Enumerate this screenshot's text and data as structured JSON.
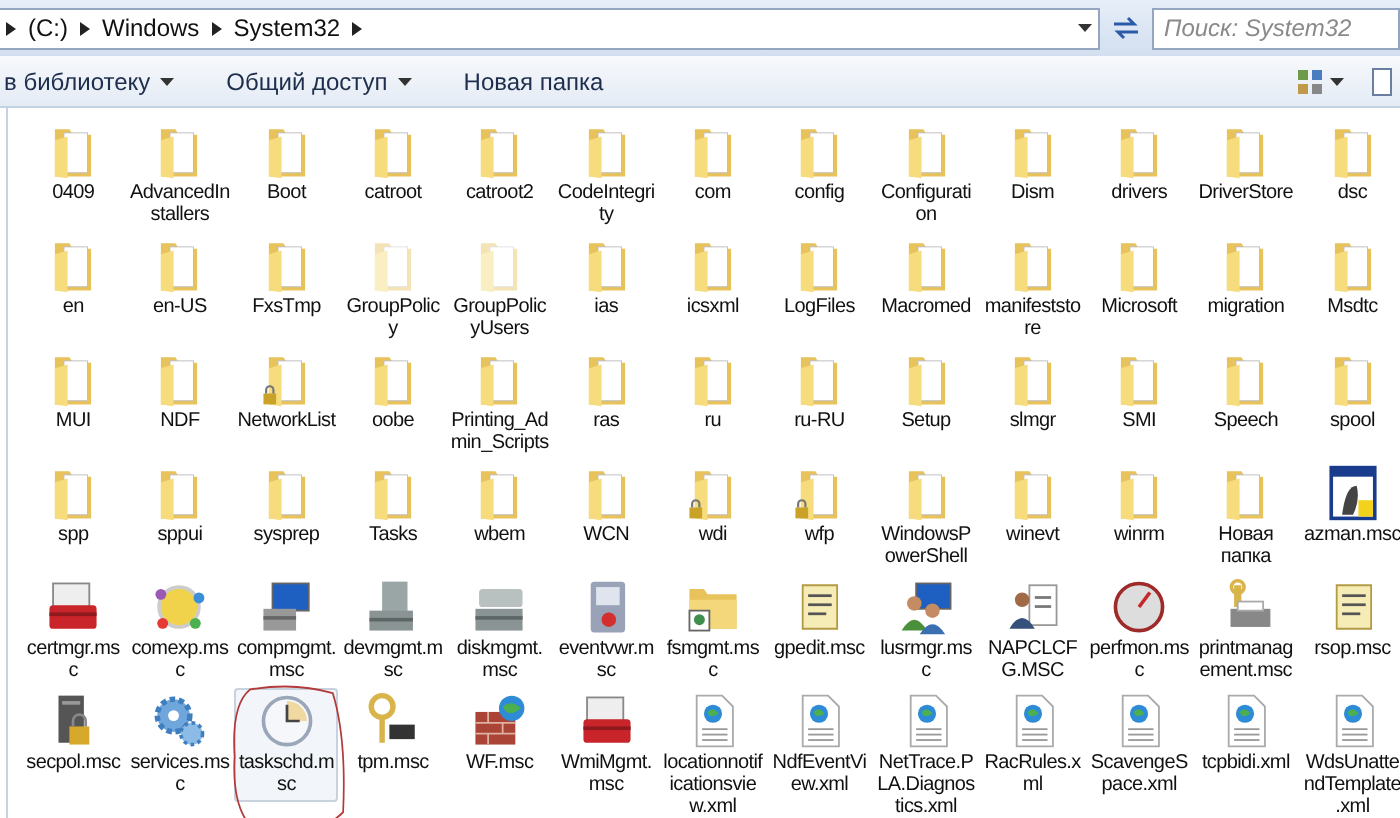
{
  "address_bar": {
    "segments": [
      "(C:)",
      "Windows",
      "System32"
    ]
  },
  "search": {
    "placeholder": "Поиск: System32"
  },
  "toolbar": {
    "buttons": [
      {
        "label": "в библиотеку",
        "menu": true
      },
      {
        "label": "Общий доступ",
        "menu": true
      },
      {
        "label": "Новая папка",
        "menu": false
      }
    ]
  },
  "items": [
    {
      "name": "0409",
      "kind": "folder",
      "selected": false,
      "circled": false
    },
    {
      "name": "AdvancedInstallers",
      "kind": "folder",
      "selected": false,
      "circled": false
    },
    {
      "name": "Boot",
      "kind": "folder",
      "selected": false,
      "circled": false
    },
    {
      "name": "catroot",
      "kind": "folder",
      "selected": false,
      "circled": false
    },
    {
      "name": "catroot2",
      "kind": "folder",
      "selected": false,
      "circled": false
    },
    {
      "name": "CodeIntegrity",
      "kind": "folder",
      "selected": false,
      "circled": false
    },
    {
      "name": "com",
      "kind": "folder",
      "selected": false,
      "circled": false
    },
    {
      "name": "config",
      "kind": "folder",
      "selected": false,
      "circled": false
    },
    {
      "name": "Configuration",
      "kind": "folder",
      "selected": false,
      "circled": false
    },
    {
      "name": "Dism",
      "kind": "folder",
      "selected": false,
      "circled": false
    },
    {
      "name": "drivers",
      "kind": "folder",
      "selected": false,
      "circled": false
    },
    {
      "name": "DriverStore",
      "kind": "folder",
      "selected": false,
      "circled": false
    },
    {
      "name": "dsc",
      "kind": "folder",
      "selected": false,
      "circled": false
    },
    {
      "name": "en",
      "kind": "folder",
      "selected": false,
      "circled": false
    },
    {
      "name": "en-US",
      "kind": "folder",
      "selected": false,
      "circled": false
    },
    {
      "name": "FxsTmp",
      "kind": "folder",
      "selected": false,
      "circled": false
    },
    {
      "name": "GroupPolicy",
      "kind": "hidden-folder",
      "selected": false,
      "circled": false
    },
    {
      "name": "GroupPolicyUsers",
      "kind": "hidden-folder",
      "selected": false,
      "circled": false
    },
    {
      "name": "ias",
      "kind": "folder",
      "selected": false,
      "circled": false
    },
    {
      "name": "icsxml",
      "kind": "folder",
      "selected": false,
      "circled": false
    },
    {
      "name": "LogFiles",
      "kind": "folder",
      "selected": false,
      "circled": false
    },
    {
      "name": "Macromed",
      "kind": "folder",
      "selected": false,
      "circled": false
    },
    {
      "name": "manifeststore",
      "kind": "folder",
      "selected": false,
      "circled": false
    },
    {
      "name": "Microsoft",
      "kind": "folder",
      "selected": false,
      "circled": false
    },
    {
      "name": "migration",
      "kind": "folder",
      "selected": false,
      "circled": false
    },
    {
      "name": "Msdtc",
      "kind": "folder",
      "selected": false,
      "circled": false
    },
    {
      "name": "MUI",
      "kind": "folder",
      "selected": false,
      "circled": false
    },
    {
      "name": "NDF",
      "kind": "folder",
      "selected": false,
      "circled": false
    },
    {
      "name": "NetworkList",
      "kind": "locked-folder",
      "selected": false,
      "circled": false
    },
    {
      "name": "oobe",
      "kind": "folder",
      "selected": false,
      "circled": false
    },
    {
      "name": "Printing_Admin_Scripts",
      "kind": "folder",
      "selected": false,
      "circled": false
    },
    {
      "name": "ras",
      "kind": "folder",
      "selected": false,
      "circled": false
    },
    {
      "name": "ru",
      "kind": "folder",
      "selected": false,
      "circled": false
    },
    {
      "name": "ru-RU",
      "kind": "folder",
      "selected": false,
      "circled": false
    },
    {
      "name": "Setup",
      "kind": "folder",
      "selected": false,
      "circled": false
    },
    {
      "name": "slmgr",
      "kind": "folder",
      "selected": false,
      "circled": false
    },
    {
      "name": "SMI",
      "kind": "folder",
      "selected": false,
      "circled": false
    },
    {
      "name": "Speech",
      "kind": "folder",
      "selected": false,
      "circled": false
    },
    {
      "name": "spool",
      "kind": "folder",
      "selected": false,
      "circled": false
    },
    {
      "name": "spp",
      "kind": "folder",
      "selected": false,
      "circled": false
    },
    {
      "name": "sppui",
      "kind": "folder",
      "selected": false,
      "circled": false
    },
    {
      "name": "sysprep",
      "kind": "folder",
      "selected": false,
      "circled": false
    },
    {
      "name": "Tasks",
      "kind": "folder",
      "selected": false,
      "circled": false
    },
    {
      "name": "wbem",
      "kind": "folder",
      "selected": false,
      "circled": false
    },
    {
      "name": "WCN",
      "kind": "folder",
      "selected": false,
      "circled": false
    },
    {
      "name": "wdi",
      "kind": "locked-folder",
      "selected": false,
      "circled": false
    },
    {
      "name": "wfp",
      "kind": "locked-folder",
      "selected": false,
      "circled": false
    },
    {
      "name": "WindowsPowerShell",
      "kind": "folder",
      "selected": false,
      "circled": false
    },
    {
      "name": "winevt",
      "kind": "folder",
      "selected": false,
      "circled": false
    },
    {
      "name": "winrm",
      "kind": "folder",
      "selected": false,
      "circled": false
    },
    {
      "name": "Новая папка",
      "kind": "folder",
      "selected": false,
      "circled": false
    },
    {
      "name": "azman.msc",
      "kind": "app-window",
      "selected": false,
      "circled": false
    },
    {
      "name": "certmgr.msc",
      "kind": "toolbox",
      "selected": false,
      "circled": false
    },
    {
      "name": "comexp.msc",
      "kind": "orb",
      "selected": false,
      "circled": false
    },
    {
      "name": "compmgmt.msc",
      "kind": "monitor",
      "selected": false,
      "circled": false
    },
    {
      "name": "devmgmt.msc",
      "kind": "server",
      "selected": false,
      "circled": false
    },
    {
      "name": "diskmgmt.msc",
      "kind": "disk",
      "selected": false,
      "circled": false
    },
    {
      "name": "eventvwr.msc",
      "kind": "log",
      "selected": false,
      "circled": false
    },
    {
      "name": "fsmgmt.msc",
      "kind": "shared-folder",
      "selected": false,
      "circled": false
    },
    {
      "name": "gpedit.msc",
      "kind": "scroll",
      "selected": false,
      "circled": false
    },
    {
      "name": "lusrmgr.msc",
      "kind": "users",
      "selected": false,
      "circled": false
    },
    {
      "name": "NAPCLCFG.MSC",
      "kind": "user-doc",
      "selected": false,
      "circled": false
    },
    {
      "name": "perfmon.msc",
      "kind": "gauge",
      "selected": false,
      "circled": false
    },
    {
      "name": "printmanagement.msc",
      "kind": "printer",
      "selected": false,
      "circled": false
    },
    {
      "name": "rsop.msc",
      "kind": "scroll",
      "selected": false,
      "circled": false
    },
    {
      "name": "secpol.msc",
      "kind": "lock-tower",
      "selected": false,
      "circled": false
    },
    {
      "name": "services.msc",
      "kind": "gears",
      "selected": false,
      "circled": false
    },
    {
      "name": "taskschd.msc",
      "kind": "clock",
      "selected": true,
      "circled": true
    },
    {
      "name": "tpm.msc",
      "kind": "key",
      "selected": false,
      "circled": false
    },
    {
      "name": "WF.msc",
      "kind": "wall",
      "selected": false,
      "circled": false
    },
    {
      "name": "WmiMgmt.msc",
      "kind": "toolbox",
      "selected": false,
      "circled": false
    },
    {
      "name": "locationnotificationsview.xml",
      "kind": "xml",
      "selected": false,
      "circled": false
    },
    {
      "name": "NdfEventView.xml",
      "kind": "xml",
      "selected": false,
      "circled": false
    },
    {
      "name": "NetTrace.PLA.Diagnostics.xml",
      "kind": "xml",
      "selected": false,
      "circled": false
    },
    {
      "name": "RacRules.xml",
      "kind": "xml",
      "selected": false,
      "circled": false
    },
    {
      "name": "ScavengeSpace.xml",
      "kind": "xml",
      "selected": false,
      "circled": false
    },
    {
      "name": "tcpbidi.xml",
      "kind": "xml",
      "selected": false,
      "circled": false
    },
    {
      "name": "WdsUnattendTemplate.xml",
      "kind": "xml",
      "selected": false,
      "circled": false
    }
  ]
}
